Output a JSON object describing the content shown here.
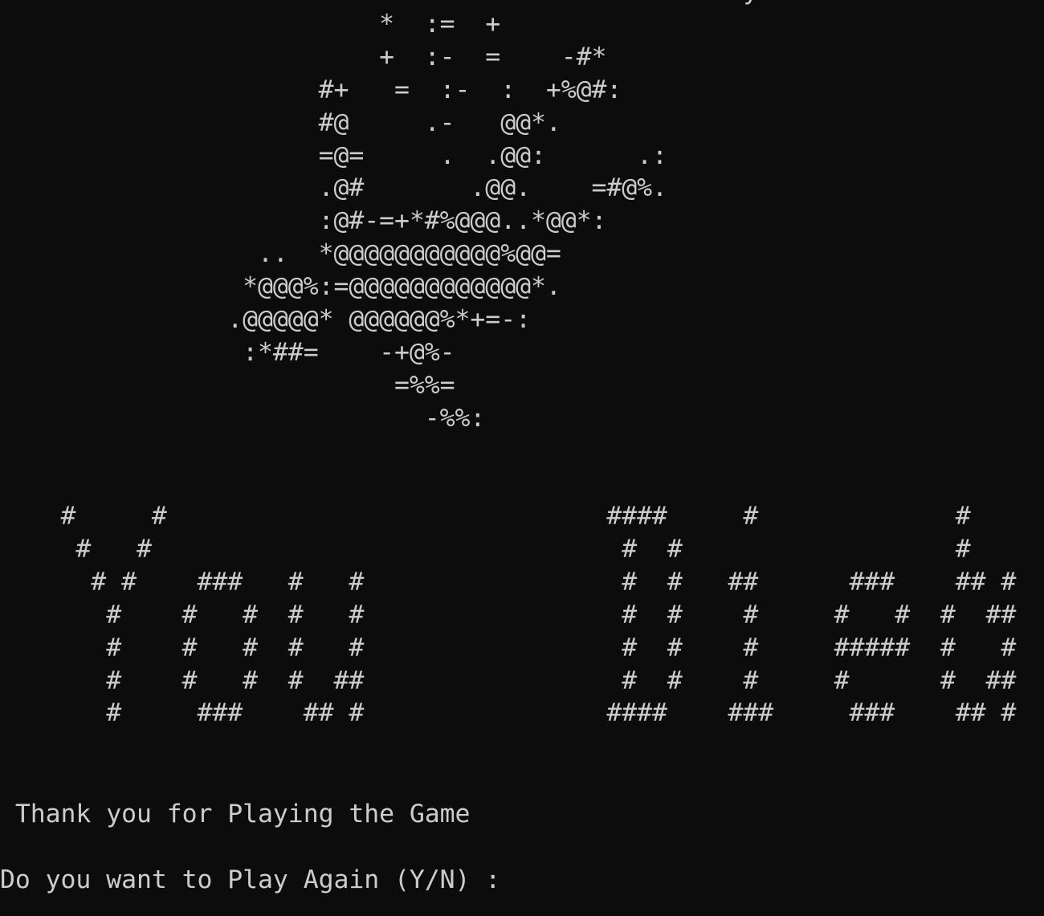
{
  "terminal": {
    "background": "#0c0c0c",
    "foreground": "#cccccc"
  },
  "skull_art": "                                                 y\n                         *  :=  +\n                         +  :-  =    -#*\n                     #+   =  :-  :  +%@#:\n                     #@     .-   @@*.\n                     =@=     .  .@@:      .:\n                     .@#       .@@.    =#@%.\n                     :@#-=+*#%@@@..*@@*:\n                 ..  *@@@@@@@@@@@%@@=\n                *@@@%:=@@@@@@@@@@@@*.\n               .@@@@@* @@@@@@%*+=-:\n                :*##=    -+@%-\n                          =%%=\n                            -%%:",
  "you_art": "    #     #\n     #   #\n      # #    ###   #   #\n       #    #   #  #   #\n       #    #   #  #   #\n       #    #   #  #  ##\n       #     ###    ## #",
  "died_art": "                                        ####     #             #\n                                         #  #                  #\n                                         #  #   ##      ###    ## #\n                                         #  #    #     #   #  #  ##\n                                         #  #    #     #####  #   #\n                                         #  #    #     #      #  ##\n                                        ####    ###     ###    ## #",
  "thanks_message": " Thank you for Playing the Game",
  "play_again_prompt": "Do you want to Play Again (Y/N) : "
}
